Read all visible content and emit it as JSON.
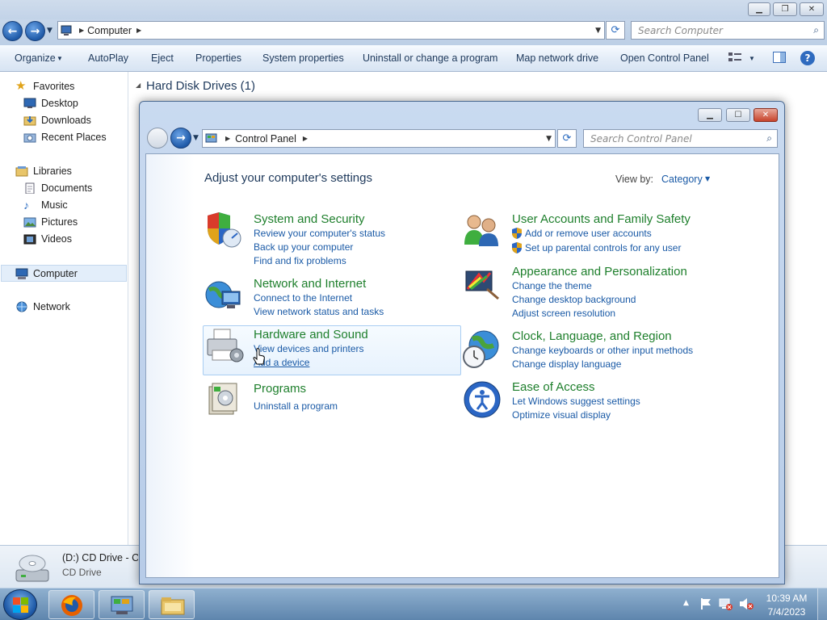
{
  "explorer": {
    "breadcrumb": "Computer",
    "search_placeholder": "Search Computer",
    "toolbar": [
      "Organize",
      "AutoPlay",
      "Eject",
      "Properties",
      "System properties",
      "Uninstall or change a program",
      "Map network drive",
      "Open Control Panel"
    ],
    "sidebar": {
      "favorites": {
        "label": "Favorites",
        "items": [
          "Desktop",
          "Downloads",
          "Recent Places"
        ]
      },
      "libraries": {
        "label": "Libraries",
        "items": [
          "Documents",
          "Music",
          "Pictures",
          "Videos"
        ]
      },
      "computer": "Computer",
      "network": "Network"
    },
    "group_header": "Hard Disk Drives (1)",
    "details": {
      "name": "(D:) CD Drive - C",
      "type": "CD Drive"
    }
  },
  "control_panel": {
    "breadcrumb": "Control Panel",
    "search_placeholder": "Search Control Panel",
    "heading": "Adjust your computer's settings",
    "view_by_label": "View by:",
    "view_by_value": "Category",
    "categories_left": [
      {
        "title": "System and Security",
        "icon": "shield-icon",
        "links": [
          "Review your computer's status",
          "Back up your computer",
          "Find and fix problems"
        ]
      },
      {
        "title": "Network and Internet",
        "icon": "globe-network-icon",
        "links": [
          "Connect to the Internet",
          "View network status and tasks"
        ]
      },
      {
        "title": "Hardware and Sound",
        "icon": "printer-icon",
        "links": [
          "View devices and printers",
          "Add a device"
        ]
      },
      {
        "title": "Programs",
        "icon": "programs-icon",
        "links": [
          "Uninstall a program"
        ]
      }
    ],
    "categories_right": [
      {
        "title": "User Accounts and Family Safety",
        "icon": "users-icon",
        "links": [
          "Add or remove user accounts",
          "Set up parental controls for any user"
        ]
      },
      {
        "title": "Appearance and Personalization",
        "icon": "paint-monitor-icon",
        "links": [
          "Change the theme",
          "Change desktop background",
          "Adjust screen resolution"
        ]
      },
      {
        "title": "Clock, Language, and Region",
        "icon": "globe-clock-icon",
        "links": [
          "Change keyboards or other input methods",
          "Change display language"
        ]
      },
      {
        "title": "Ease of Access",
        "icon": "ease-of-access-icon",
        "links": [
          "Let Windows suggest settings",
          "Optimize visual display"
        ]
      }
    ]
  },
  "taskbar": {
    "time": "10:39 AM",
    "date": "7/4/2023"
  },
  "colors": {
    "category_title": "#1e7f2c",
    "link": "#1a5aa6",
    "heading": "#1e395b"
  }
}
